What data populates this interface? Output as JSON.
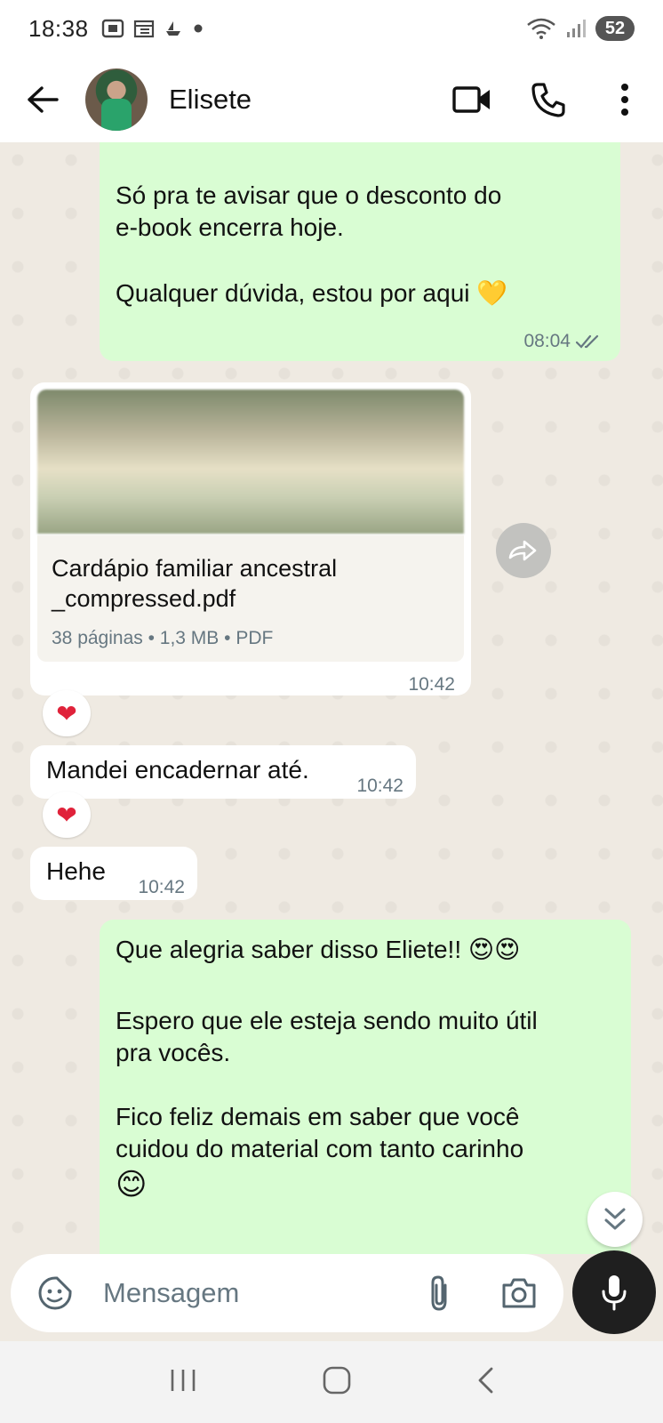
{
  "status_bar": {
    "time": "18:38",
    "battery": "52",
    "notif_icons": [
      "screenshot-icon",
      "calendar-icon",
      "boat-icon",
      "dot-icon"
    ]
  },
  "header": {
    "contact_name": "Elisete"
  },
  "messages": {
    "m1": {
      "line1": "Só pra te avisar que o desconto do",
      "line2": "e-book encerra hoje.",
      "line3": "Qualquer dúvida, estou por aqui 💛",
      "time": "08:04"
    },
    "doc": {
      "title_line1": "Cardápio familiar ancestral",
      "title_line2": "_compressed.pdf",
      "details": "38 páginas • 1,3 MB • PDF",
      "time": "10:42",
      "reaction": "❤"
    },
    "m2": {
      "text": "Mandei encadernar até.",
      "time": "10:42",
      "reaction": "❤"
    },
    "m3": {
      "text": "Hehe",
      "time": "10:42"
    },
    "m4": {
      "line1": "Que alegria saber disso Eliete!! 😍😍",
      "line2": "Espero que ele esteja sendo muito útil",
      "line3": "pra vocês.",
      "line4": "Fico feliz demais em saber que você",
      "line5": "cuidou do material com tanto carinho",
      "line6": "😊"
    }
  },
  "input": {
    "placeholder": "Mensagem"
  },
  "colors": {
    "outgoing_bubble": "#d9fdd3",
    "incoming_bubble": "#ffffff",
    "chat_background": "#efeae2"
  }
}
